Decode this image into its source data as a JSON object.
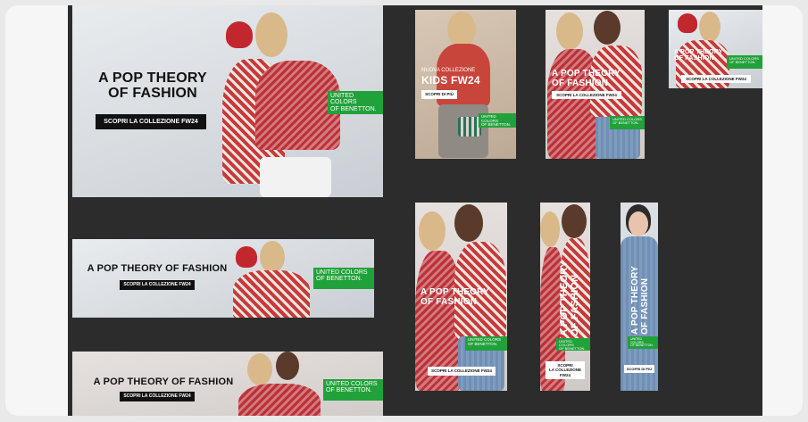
{
  "campaign": {
    "headline_two_line_1": "A POP THEORY",
    "headline_two_line_2": "OF FASHION",
    "headline_one_line": "A POP THEORY OF FASHION",
    "cta_full": "SCOPRI LA COLLEZIONE FW24",
    "cta_short": "SCOPRI DI PIÙ",
    "cta_stack_1": "SCOPRI",
    "cta_stack_2": "LA COLLEZIONE",
    "cta_stack_3": "FW24",
    "brand_line_1": "UNITED COLORS",
    "brand_line_2": "OF BENETTON.",
    "kids_tag": "NUOVA COLLEZIONE",
    "kids_title": "KIDS FW24"
  },
  "colors": {
    "board": "#2c2c2c",
    "brand_green": "#21a13a",
    "cta_black": "#111111"
  }
}
